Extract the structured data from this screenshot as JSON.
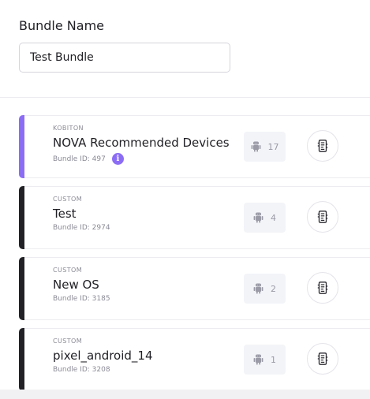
{
  "form": {
    "label": "Bundle Name",
    "value": "Test Bundle"
  },
  "colors": {
    "kobiton_accent": "#8b6df5",
    "custom_accent": "#222226",
    "info_icon": "#8b6df5"
  },
  "bundles": [
    {
      "type": "KOBITON",
      "name": "NOVA Recommended Devices",
      "id_label": "Bundle ID: 497",
      "device_count": "17",
      "platform_icon": "android-icon",
      "has_info": true,
      "info_glyph": "i",
      "action_icon": "device-list-icon"
    },
    {
      "type": "CUSTOM",
      "name": "Test",
      "id_label": "Bundle ID: 2974",
      "device_count": "4",
      "platform_icon": "android-icon",
      "has_info": false,
      "action_icon": "device-list-icon"
    },
    {
      "type": "CUSTOM",
      "name": "New OS",
      "id_label": "Bundle ID: 3185",
      "device_count": "2",
      "platform_icon": "android-icon",
      "has_info": false,
      "action_icon": "device-list-icon"
    },
    {
      "type": "CUSTOM",
      "name": "pixel_android_14",
      "id_label": "Bundle ID: 3208",
      "device_count": "1",
      "platform_icon": "android-icon",
      "has_info": false,
      "action_icon": "device-list-icon"
    }
  ]
}
